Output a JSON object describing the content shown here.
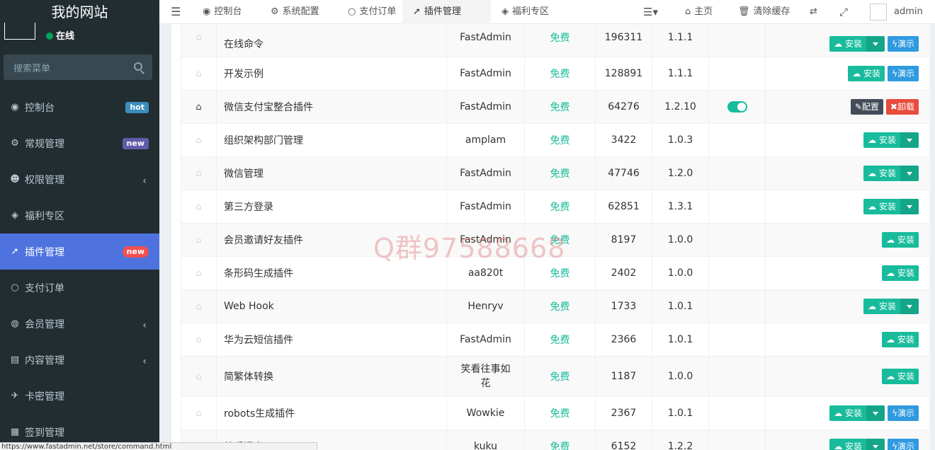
{
  "site_title": "我的网站",
  "user_status": "在线",
  "search_placeholder": "搜索菜单",
  "menu": [
    {
      "label": "控制台",
      "icon": "dashboard-icon",
      "glyph": "◉",
      "badge": "hot"
    },
    {
      "label": "常规管理",
      "icon": "cogs-icon",
      "glyph": "⚙",
      "badge": "new"
    },
    {
      "label": "权限管理",
      "icon": "users-icon",
      "glyph": "☻",
      "chevron": "‹"
    },
    {
      "label": "福利专区",
      "icon": "cube-icon",
      "glyph": "◈"
    },
    {
      "label": "插件管理",
      "icon": "rocket-icon",
      "glyph": "➚",
      "badge": "new",
      "active": true
    },
    {
      "label": "支付订单",
      "icon": "circle-icon",
      "glyph": "○"
    },
    {
      "label": "会员管理",
      "icon": "user-circle-icon",
      "glyph": "◍",
      "chevron": "‹"
    },
    {
      "label": "内容管理",
      "icon": "file-icon",
      "glyph": "▤",
      "chevron": "‹"
    },
    {
      "label": "卡密管理",
      "icon": "paper-plane-icon",
      "glyph": "✈"
    },
    {
      "label": "签到管理",
      "icon": "calendar-icon",
      "glyph": "▦"
    }
  ],
  "topnav": {
    "tabs": [
      {
        "label": "控制台",
        "icon": "dashboard-icon",
        "glyph": "◉"
      },
      {
        "label": "系统配置",
        "icon": "gear-icon",
        "glyph": "⚙"
      },
      {
        "label": "支付订单",
        "icon": "circle-icon",
        "glyph": "○"
      },
      {
        "label": "插件管理",
        "icon": "rocket-icon",
        "glyph": "➚",
        "active": true
      },
      {
        "label": "福利专区",
        "icon": "cube-icon",
        "glyph": "◈"
      }
    ],
    "home_label": "主页",
    "clear_cache_label": "清除缓存",
    "user_name": "admin"
  },
  "plugins": [
    {
      "name": "在线命令",
      "author": "FastAdmin",
      "price": "免费",
      "downloads": "196311",
      "version": "1.1.1",
      "actions": [
        "install-split",
        "demo"
      ]
    },
    {
      "name": "开发示例",
      "author": "FastAdmin",
      "price": "免费",
      "downloads": "128891",
      "version": "1.1.1",
      "actions": [
        "install",
        "demo"
      ]
    },
    {
      "name": "微信支付宝整合插件",
      "author": "FastAdmin",
      "price": "免费",
      "downloads": "64276",
      "version": "1.2.10",
      "installed": true,
      "enabled": true,
      "actions": [
        "config",
        "uninstall"
      ]
    },
    {
      "name": "组织架构部门管理",
      "author": "amplam",
      "price": "免费",
      "downloads": "3422",
      "version": "1.0.3",
      "actions": [
        "install-split"
      ]
    },
    {
      "name": "微信管理",
      "author": "FastAdmin",
      "price": "免费",
      "downloads": "47746",
      "version": "1.2.0",
      "actions": [
        "install-split"
      ]
    },
    {
      "name": "第三方登录",
      "author": "FastAdmin",
      "price": "免费",
      "downloads": "62851",
      "version": "1.3.1",
      "actions": [
        "install-split"
      ]
    },
    {
      "name": "会员邀请好友插件",
      "author": "FastAdmin",
      "price": "免费",
      "downloads": "8197",
      "version": "1.0.0",
      "actions": [
        "install"
      ]
    },
    {
      "name": "条形码生成插件",
      "author": "aa820t",
      "price": "免费",
      "downloads": "2402",
      "version": "1.0.0",
      "actions": [
        "install"
      ]
    },
    {
      "name": "Web Hook",
      "author": "Henryv",
      "price": "免费",
      "downloads": "1733",
      "version": "1.0.1",
      "actions": [
        "install-split"
      ]
    },
    {
      "name": "华为云短信插件",
      "author": "FastAdmin",
      "price": "免费",
      "downloads": "2366",
      "version": "1.0.1",
      "actions": [
        "install"
      ]
    },
    {
      "name": "简繁体转换",
      "author": "笑看往事如花",
      "price": "免费",
      "downloads": "1187",
      "version": "1.0.0",
      "actions": [
        "install"
      ]
    },
    {
      "name": "robots生成插件",
      "author": "Wowkie",
      "price": "免费",
      "downloads": "2367",
      "version": "1.0.1",
      "actions": [
        "install-split",
        "demo"
      ]
    },
    {
      "name": "绩手课表",
      "author": "kuku",
      "price": "免费",
      "downloads": "6152",
      "version": "1.2.2",
      "actions": [
        "install-split",
        "demo"
      ]
    }
  ],
  "labels": {
    "install": "安装",
    "demo": "演示",
    "config": "配置",
    "uninstall": "卸载"
  },
  "watermark": "Q群97588668",
  "status_url": "https://www.fastadmin.net/store/command.html"
}
